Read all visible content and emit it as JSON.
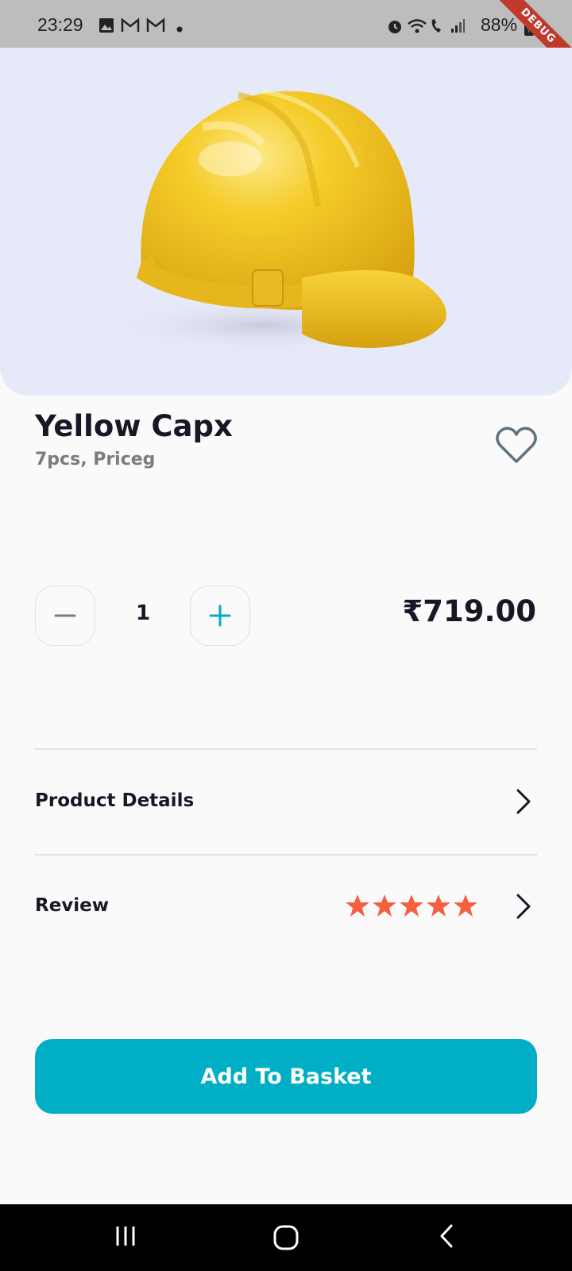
{
  "status_bar": {
    "time": "23:29",
    "battery": "88%",
    "debug_label": "DEBUG"
  },
  "product": {
    "title": "Yellow Capx",
    "subtitle": "7pcs, Priceg",
    "quantity": "1",
    "price": "₹719.00",
    "image_description_icon": "yellow-hard-hat-image"
  },
  "sections": {
    "details_label": "Product Details",
    "review_label": "Review",
    "rating_stars": 5,
    "star_color": "#f3603f"
  },
  "actions": {
    "add_to_basket": "Add To Basket"
  },
  "colors": {
    "accent": "#00aec6",
    "hero_bg": "#e6eaf8",
    "helmet": "#f2c21b"
  }
}
